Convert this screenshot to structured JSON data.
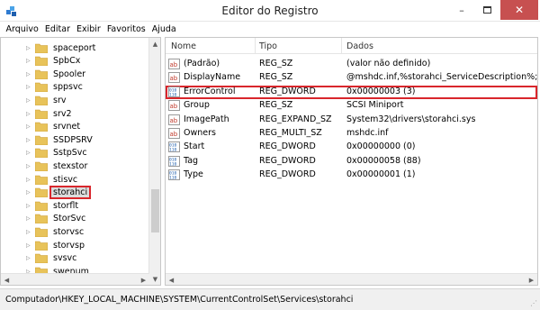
{
  "window": {
    "title": "Editor do Registro",
    "minimize": "–",
    "close": "✕"
  },
  "menu": [
    "Arquivo",
    "Editar",
    "Exibir",
    "Favoritos",
    "Ajuda"
  ],
  "tree": {
    "items": [
      {
        "label": "spaceport"
      },
      {
        "label": "SpbCx"
      },
      {
        "label": "Spooler"
      },
      {
        "label": "sppsvc"
      },
      {
        "label": "srv"
      },
      {
        "label": "srv2"
      },
      {
        "label": "srvnet"
      },
      {
        "label": "SSDPSRV"
      },
      {
        "label": "SstpSvc"
      },
      {
        "label": "stexstor"
      },
      {
        "label": "stisvc"
      },
      {
        "label": "storahci",
        "selected": true
      },
      {
        "label": "storflt"
      },
      {
        "label": "StorSvc"
      },
      {
        "label": "storvsc"
      },
      {
        "label": "storvsp"
      },
      {
        "label": "svsvc"
      },
      {
        "label": "swenum"
      }
    ]
  },
  "list": {
    "columns": [
      "Nome",
      "Tipo",
      "Dados"
    ],
    "rows": [
      {
        "name": "(Padrão)",
        "type": "REG_SZ",
        "data": "(valor não definido)",
        "icon": "string-value-icon"
      },
      {
        "name": "DisplayName",
        "type": "REG_SZ",
        "data": "@mshdc.inf,%storahci_ServiceDescription%;Micr",
        "icon": "string-value-icon"
      },
      {
        "name": "ErrorControl",
        "type": "REG_DWORD",
        "data": "0x00000003 (3)",
        "icon": "binary-value-icon",
        "selected": true
      },
      {
        "name": "Group",
        "type": "REG_SZ",
        "data": "SCSI Miniport",
        "icon": "string-value-icon"
      },
      {
        "name": "ImagePath",
        "type": "REG_EXPAND_SZ",
        "data": "System32\\drivers\\storahci.sys",
        "icon": "string-value-icon"
      },
      {
        "name": "Owners",
        "type": "REG_MULTI_SZ",
        "data": "mshdc.inf",
        "icon": "string-value-icon"
      },
      {
        "name": "Start",
        "type": "REG_DWORD",
        "data": "0x00000000 (0)",
        "icon": "binary-value-icon"
      },
      {
        "name": "Tag",
        "type": "REG_DWORD",
        "data": "0x00000058 (88)",
        "icon": "binary-value-icon"
      },
      {
        "name": "Type",
        "type": "REG_DWORD",
        "data": "0x00000001 (1)",
        "icon": "binary-value-icon"
      }
    ]
  },
  "status": {
    "path": "Computador\\HKEY_LOCAL_MACHINE\\SYSTEM\\CurrentControlSet\\Services\\storahci"
  },
  "colors": {
    "highlight": "#d9262c",
    "folder": "#e8c35a",
    "close_button": "#c75050"
  }
}
